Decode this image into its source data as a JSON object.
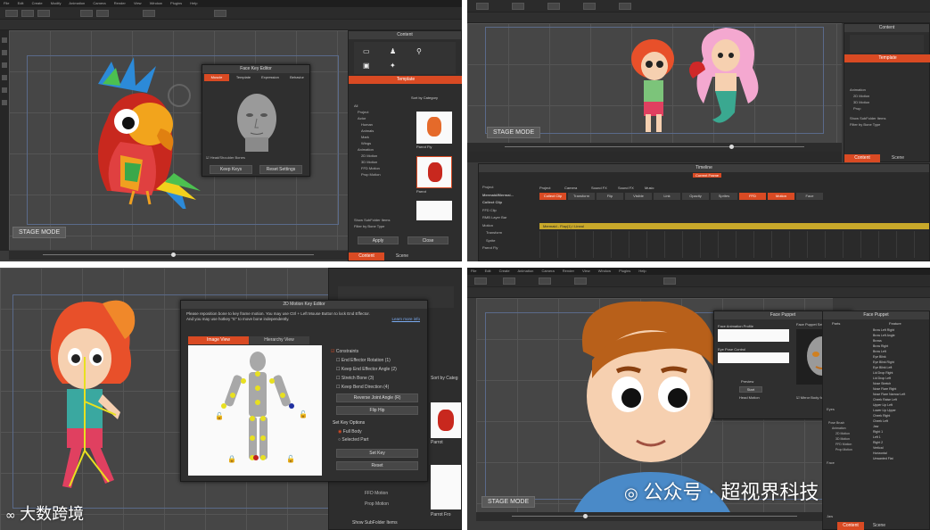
{
  "q1": {
    "menu": [
      "File",
      "Edit",
      "Create",
      "Modify",
      "Animation",
      "Camera",
      "Render",
      "View",
      "Window",
      "Plugins",
      "Help"
    ],
    "stage_mode": "STAGE MODE",
    "dialog": {
      "title": "Face Key Editor",
      "tabs": [
        "Muscle",
        "Template",
        "Expression",
        "Behavior"
      ],
      "checkbox": "Head/Shoulder Bones",
      "buttons": [
        "Keep Keys",
        "Reset Settings"
      ]
    },
    "content": {
      "title": "Content",
      "sub_title": "Template",
      "sort": "Sort by Category",
      "tree": [
        "All",
        "Project",
        "Actor",
        "Human",
        "Animals",
        "Mark",
        "Wings",
        "Animation",
        "2D Motion",
        "3D Motion",
        "FFD Motion",
        "Prop Motion"
      ],
      "thumb_labels": [
        "Parrot Fly",
        "Parrot"
      ],
      "footer": [
        "Show SubFolder Items",
        "Filter by Bone Type"
      ],
      "buttons": [
        "Apply",
        "Close"
      ],
      "bottom_tabs": [
        "Content",
        "Scene"
      ]
    }
  },
  "q2": {
    "stage_mode": "STAGE MODE",
    "content": {
      "title": "Content",
      "sub_title": "Template",
      "tree": [
        "Animation",
        "2D Motion",
        "3D Motion",
        "Prop"
      ],
      "footer": [
        "Show SubFolder Items",
        "Filter by Bone Type"
      ],
      "bottom_tabs": [
        "Content",
        "Scene"
      ]
    },
    "timeline": {
      "title": "Timeline",
      "rows": [
        "Project",
        "Mermaid/Mermai...",
        "Collect Clip",
        "FFD Clip",
        "RMB Layer Bar",
        "Motion",
        "Transform",
        "Sprite",
        "Parrot Fly"
      ],
      "tracks": [
        "Project",
        "Camera",
        "Sound FX",
        "Sound FX",
        "Music"
      ],
      "cells": [
        "Collect Clip",
        "Transform",
        "Flip",
        "Visible",
        "Link",
        "Opacity",
        "Sprites",
        "FFD",
        "Motion",
        "Face"
      ],
      "motion_label": "Mermaid - Flap(1) / Lineal",
      "current_frame": "Current Frame"
    }
  },
  "q3": {
    "dialog": {
      "title": "2D Motion Key Editor",
      "help_1": "Please reposition bone to key frame motion. You may use Ctrl + Left Mouse Button to lock End Effector.",
      "help_2": "And you may use hotkey \"E\" to move bone independently.",
      "link": "Learn more info",
      "tabs": [
        "Image View",
        "Hierarchy View"
      ],
      "constraints": "Constraints",
      "options": [
        "End Effector Rotation (1)",
        "Keep End Effector Angle (2)",
        "Stretch Bone (3)",
        "Keep Bend Direction (4)"
      ],
      "buttons": [
        "Reverse Joint Angle (R)",
        "Flip Hip",
        "Set Key",
        "Reset"
      ],
      "set_key_options": "Set Key Options",
      "radios": [
        "Full Body",
        "Selected Part"
      ]
    },
    "side": {
      "sort": "Sort by Categ",
      "thumbs": [
        "Parrot",
        "Parrot Fro"
      ],
      "tree": [
        "FFD Motion",
        "Prop Motion"
      ],
      "footer": "Show SubFolder Items"
    }
  },
  "q4": {
    "menu": [
      "File",
      "Edit",
      "Create",
      "Animation",
      "Camera",
      "Render",
      "View",
      "Window",
      "Plugins",
      "Help"
    ],
    "stage_mode": "STAGE MODE",
    "dialog": {
      "title": "Face Puppet",
      "animation_profile": "Face Animation Profile",
      "eye_control": "Eye Pose Control",
      "preview_label": "Preview",
      "start": "Start",
      "head_motion": "Head Motion",
      "right_title": "Face Puppet Selection",
      "checkbox": "Mirror Body for face Animation"
    },
    "face_panel": {
      "title": "Face Puppet",
      "header": [
        "Parts",
        "Feature"
      ],
      "groups": [
        "Eyes",
        "Face",
        "Jaw"
      ],
      "features": [
        "Brow Left Right",
        "Brow Left Angle",
        "Brows",
        "Brow Right",
        "Brow Left",
        "Eye Blink",
        "Eye Blink Right",
        "Eye Blink Left",
        "Lid Drop Right",
        "Lid Drop Left",
        "Nose Stretch",
        "Nose Flare Right",
        "Nose Flare Narrow Left",
        "Cheek Raise Left",
        "Upper Lip Left",
        "Lower Lip Upper",
        "Cheek Right",
        "Cheek Left",
        "Jaw",
        "Right 1",
        "Left 1",
        "Right 2",
        "Vertical",
        "Horizontal",
        "Unwanted Flat"
      ],
      "tree": [
        "Pose Brush",
        "Animation",
        "2D Motion",
        "3D Motion",
        "FFD Motion",
        "Prop Motion"
      ],
      "bottom_tabs": [
        "Content",
        "Scene"
      ]
    }
  },
  "watermarks": {
    "left": "大数跨境",
    "right": "公众号 · 超视界科技"
  },
  "colors": {
    "accent": "#d94a23",
    "ui_dark": "#2d2d2d",
    "stage": "#464646",
    "bone": "#e8e020"
  }
}
